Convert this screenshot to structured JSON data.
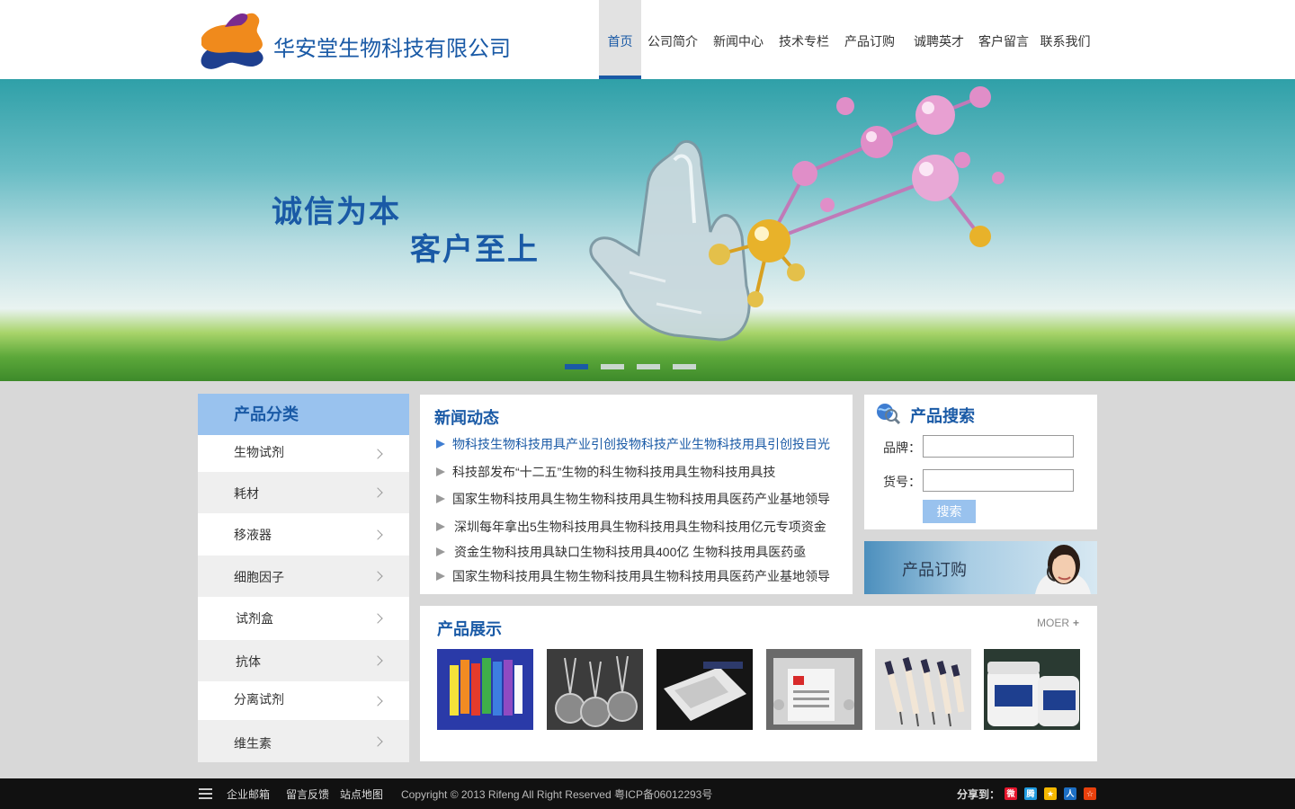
{
  "header": {
    "company_name": "华安堂生物科技有限公司",
    "nav": [
      {
        "label": "首页",
        "active": true
      },
      {
        "label": "公司简介"
      },
      {
        "label": "新闻中心"
      },
      {
        "label": "技术专栏"
      },
      {
        "label": "产品订购"
      },
      {
        "label": "诚聘英才"
      },
      {
        "label": "客户留言"
      },
      {
        "label": "联系我们"
      }
    ]
  },
  "banner": {
    "slogan_line1": "诚信为本",
    "slogan_line2": "客户至上",
    "slide_count": 4,
    "active_slide": 1
  },
  "categories": {
    "title": "产品分类",
    "items": [
      {
        "label": "生物试剂"
      },
      {
        "label": "耗材"
      },
      {
        "label": "移液器"
      },
      {
        "label": "细胞因子"
      },
      {
        "label": "试剂盒"
      },
      {
        "label": "抗体"
      },
      {
        "label": "分离试剂"
      },
      {
        "label": "维生素"
      }
    ]
  },
  "news": {
    "title": "新闻动态",
    "items": [
      "物科技生物科技用具产业引创投物科技产业生物科技用具引创投目光",
      "科技部发布“十二五”生物的科生物科技用具生物科技用具技",
      "国家生物科技用具生物生物科技用具生物科技用具医药产业基地领导",
      "深圳每年拿出5生物科技用具生物科技用具生物科技用亿元专项资金",
      "资金生物科技用具缺口生物科技用具400亿 生物科技用具医药亟",
      "国家生物科技用具生物生物科技用具生物科技用具医药产业基地领导"
    ]
  },
  "search": {
    "title": "产品搜索",
    "brand_label": "品牌：",
    "brand_value": "",
    "sku_label": "货号：",
    "sku_value": "",
    "button_label": "搜索"
  },
  "order_banner": {
    "text": "产品订购"
  },
  "products": {
    "title": "产品展示",
    "more_label": "MOER",
    "items": [
      {
        "name": "colorful-tube-racks"
      },
      {
        "name": "cell-strainers"
      },
      {
        "name": "platemax-sealing-film"
      },
      {
        "name": "membrane-plate"
      },
      {
        "name": "pipettes"
      },
      {
        "name": "agarose-jars"
      }
    ]
  },
  "footer": {
    "links": [
      "企业邮箱",
      "留言反馈",
      "站点地图"
    ],
    "copyright": "Copyright © 2013 Rifeng All Right Reserved 粤ICP备06012293号",
    "share_label": "分享到：",
    "share_icons": [
      {
        "name": "weibo-icon",
        "color": "#e6162d"
      },
      {
        "name": "tencent-weibo-icon",
        "color": "#1f9be0"
      },
      {
        "name": "qzone-icon",
        "color": "#f5b800"
      },
      {
        "name": "renren-icon",
        "color": "#1d6fc4"
      },
      {
        "name": "douban-icon",
        "color": "#e8400c"
      }
    ]
  },
  "colors": {
    "brand_blue": "#1a5aa6",
    "light_blue": "#99c2ee",
    "page_bg": "#d8d8d8",
    "footer_bg": "#111111"
  }
}
